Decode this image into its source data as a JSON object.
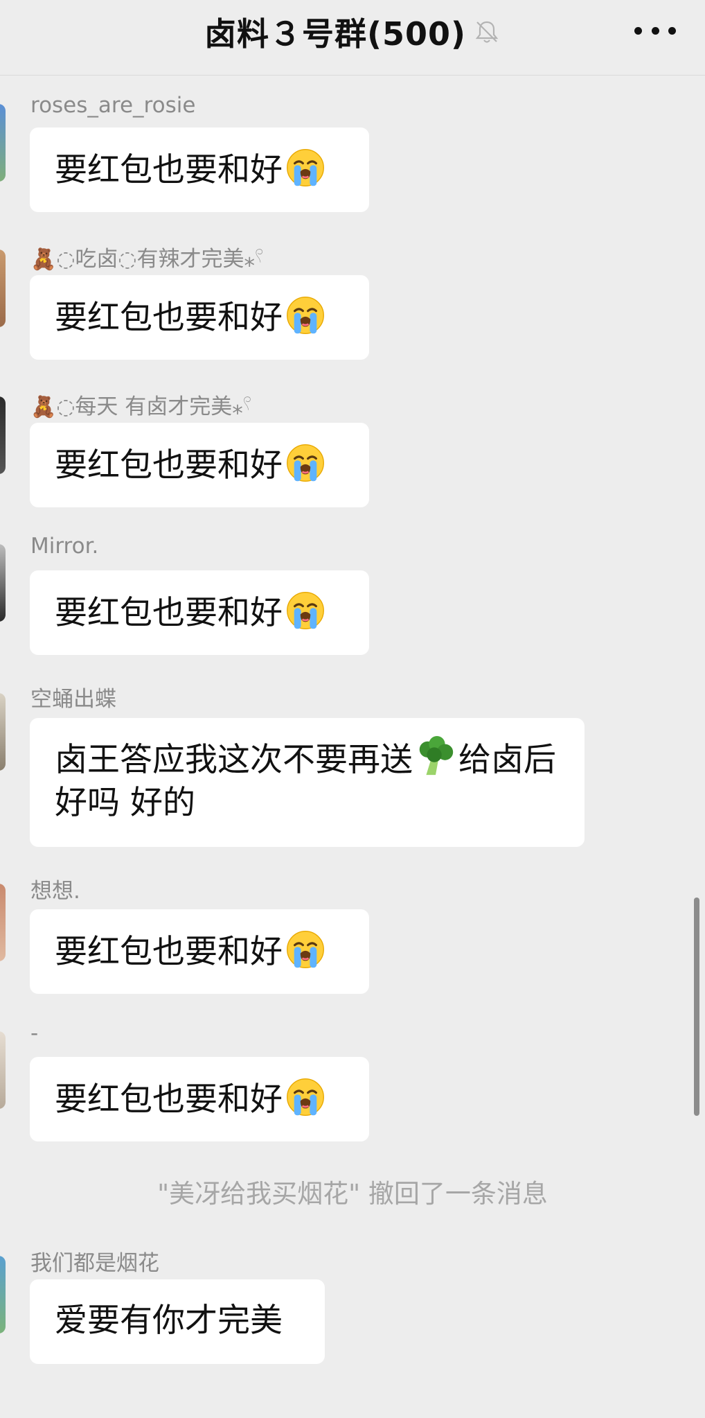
{
  "header": {
    "title": "卤料３号群(500)",
    "mute_icon": "bell-slash-icon",
    "more_icon": "more-dots-icon"
  },
  "messages": [
    {
      "sender": "roses_are_rosie",
      "text": "要红包也要和好",
      "emoji": "loudly-crying-face"
    },
    {
      "sender_emoji": "🧸",
      "sender": "◌吃卤◌有辣才完美⁎𓍢",
      "text": "要红包也要和好",
      "emoji": "loudly-crying-face"
    },
    {
      "sender_emoji": "🧸",
      "sender": "◌每天 有卤才完美⁎𓍢",
      "text": "要红包也要和好",
      "emoji": "loudly-crying-face"
    },
    {
      "sender": "Mirror.",
      "text": "要红包也要和好",
      "emoji": "loudly-crying-face"
    },
    {
      "sender": "空蛹出蝶",
      "text_part1": "卤王答应我这次不要再送",
      "text_part2": "给卤后好吗  好的",
      "emoji": "broccoli"
    },
    {
      "sender": "想想.",
      "text": "要红包也要和好",
      "emoji": "loudly-crying-face"
    },
    {
      "sender": "-",
      "text": "要红包也要和好",
      "emoji": "loudly-crying-face"
    },
    {
      "sender": "我们都是烟花",
      "text": "爱要有你才完美"
    }
  ],
  "system_notice": "\"美冴给我买烟花\" 撤回了一条消息",
  "colors": {
    "background": "#ededed",
    "bubble": "#ffffff",
    "sender_text": "#8a8a8a",
    "system_text": "#a6a6a6"
  }
}
